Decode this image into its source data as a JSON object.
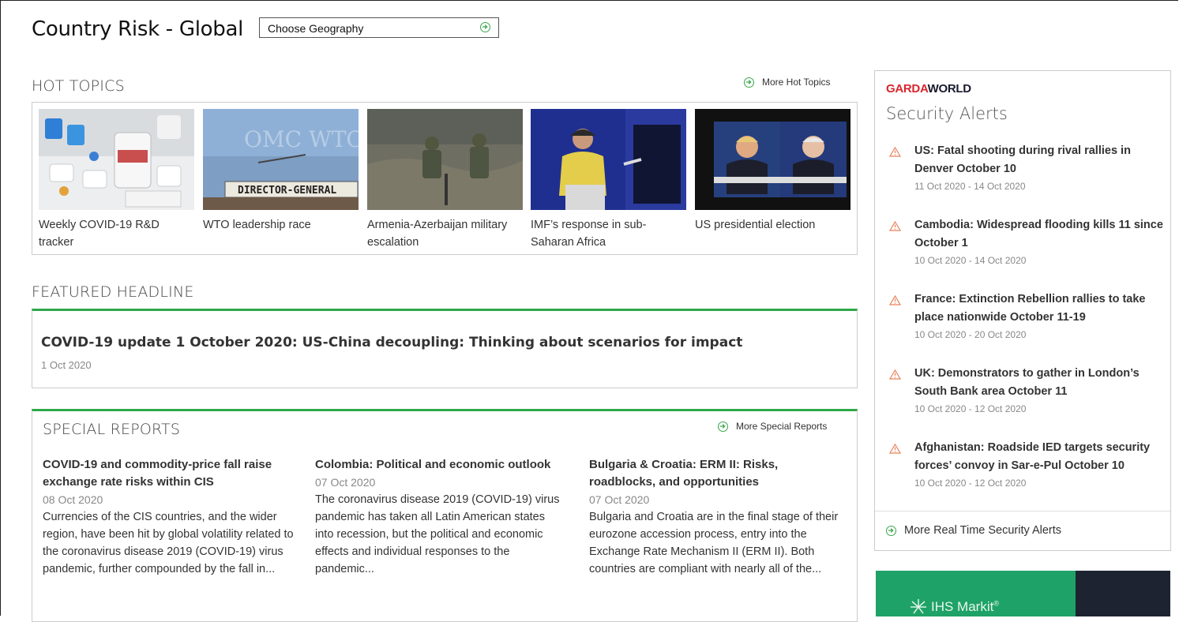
{
  "header": {
    "title": "Country Risk - Global",
    "geography_label": "Choose Geography"
  },
  "hot_topics": {
    "heading": "HOT TOPICS",
    "more_label": "More Hot Topics",
    "items": [
      {
        "caption": "Weekly COVID-19 R&D tracker"
      },
      {
        "caption": "WTO leadership race",
        "sign_text": "DIRECTOR-GENERAL",
        "bg_text": "OMC WTO"
      },
      {
        "caption": "Armenia-Azerbaijan military escalation"
      },
      {
        "caption": "IMF’s response in sub-Saharan Africa"
      },
      {
        "caption": "US presidential election"
      }
    ]
  },
  "featured": {
    "heading": "FEATURED HEADLINE",
    "title": "COVID-19 update 1 October 2020: US-China decoupling: Thinking about scenarios for impact",
    "date": "1 Oct 2020"
  },
  "special_reports": {
    "heading": "SPECIAL REPORTS",
    "more_label": "More Special Reports",
    "items": [
      {
        "title": "COVID-19 and commodity-price fall raise exchange rate risks within CIS",
        "date": "08 Oct 2020",
        "summary": "Currencies of the CIS countries, and the wider region, have been hit by global volatility related to the coronavirus disease 2019 (COVID-19) virus pandemic, further compounded by the fall in..."
      },
      {
        "title": "Colombia: Political and economic outlook",
        "date": "07 Oct 2020",
        "summary": "The coronavirus disease 2019 (COVID-19) virus pandemic has taken all Latin American states into recession, but the political and economic effects and individual responses to the pandemic..."
      },
      {
        "title": "Bulgaria & Croatia: ERM II: Risks, roadblocks, and opportunities",
        "date": "07 Oct 2020",
        "summary": "Bulgaria and Croatia are in the final stage of their eurozone accession process, entry into the Exchange Rate Mechanism II (ERM II). Both countries are compliant with nearly all of the..."
      }
    ]
  },
  "sidebar": {
    "logo_red": "GARDA",
    "logo_dark": "WORLD",
    "heading": "Security Alerts",
    "alerts": [
      {
        "title": "US: Fatal shooting during rival rallies in Denver October 10",
        "dates": "11 Oct 2020 - 14 Oct 2020"
      },
      {
        "title": "Cambodia: Widespread flooding kills 11 since October 1",
        "dates": "10 Oct 2020 - 14 Oct 2020"
      },
      {
        "title": "France: Extinction Rebellion rallies to take place nationwide October 11-19",
        "dates": "10 Oct 2020 - 20 Oct 2020"
      },
      {
        "title": "UK: Demonstrators to gather in London’s South Bank area October 11",
        "dates": "10 Oct 2020 - 12 Oct 2020"
      },
      {
        "title": "Afghanistan: Roadside IED targets security forces’ convoy in Sar-e-Pul October 10",
        "dates": "10 Oct 2020 - 12 Oct 2020"
      }
    ],
    "more_label": "More Real Time Security Alerts"
  },
  "ad": {
    "text": "IHS Markit",
    "mark": "®"
  },
  "colors": {
    "accent_green": "#2ea84a",
    "alert_orange": "#e8825a",
    "garda_red": "#d7262e",
    "ad_green": "#1fa267"
  },
  "icons": {
    "circle_arrow": "circle-arrow-icon",
    "warning": "warning-triangle-icon"
  }
}
